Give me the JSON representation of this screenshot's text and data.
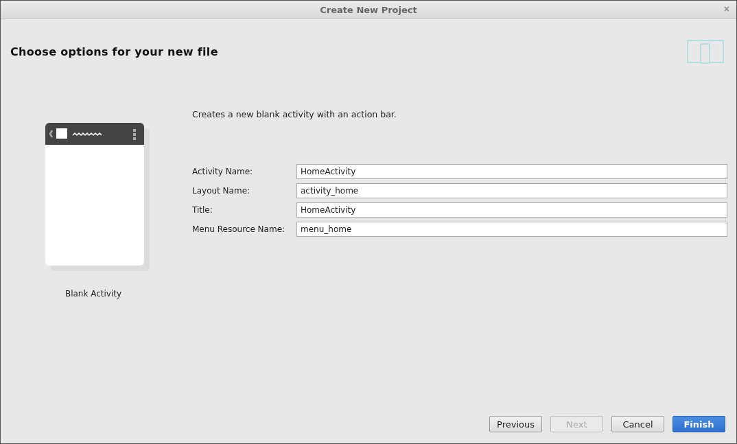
{
  "window": {
    "title": "Create New Project",
    "close": "×"
  },
  "header": {
    "title": "Choose options for your new file"
  },
  "template": {
    "name": "Blank Activity"
  },
  "description": "Creates a new blank activity with an action bar.",
  "fields": [
    {
      "label": "Activity Name:",
      "value": "HomeActivity"
    },
    {
      "label": "Layout Name:",
      "value": "activity_home"
    },
    {
      "label": "Title:",
      "value": "HomeActivity"
    },
    {
      "label": "Menu Resource Name:",
      "value": "menu_home"
    }
  ],
  "buttons": [
    {
      "label": "Previous",
      "kind": "default",
      "disabled": false
    },
    {
      "label": "Next",
      "kind": "default",
      "disabled": true
    },
    {
      "label": "Cancel",
      "kind": "default",
      "disabled": false
    },
    {
      "label": "Finish",
      "kind": "primary",
      "disabled": false
    }
  ]
}
